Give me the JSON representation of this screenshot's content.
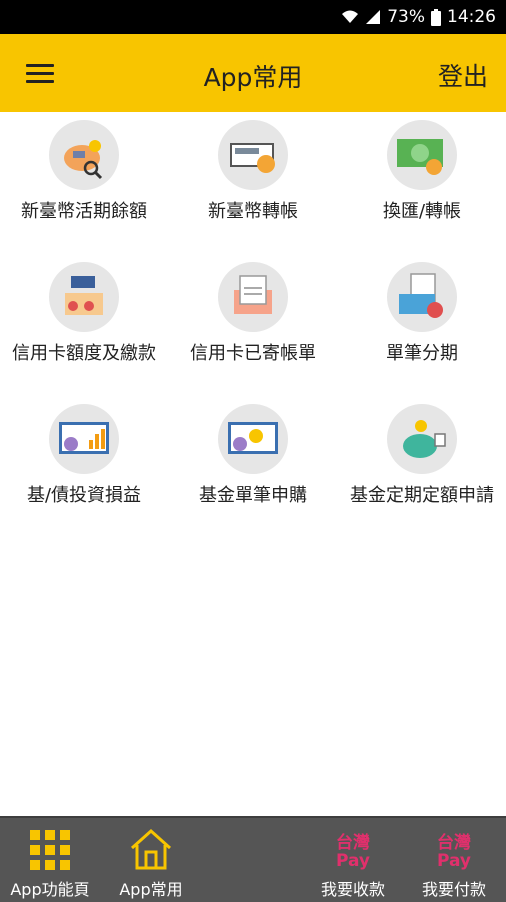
{
  "statusbar": {
    "battery": "73%",
    "time": "14:26"
  },
  "header": {
    "title": "App常用",
    "logout": "登出"
  },
  "tiles": [
    {
      "label": "新臺幣活期餘額",
      "icon": "piggy-bank-search-icon"
    },
    {
      "label": "新臺幣轉帳",
      "icon": "transfer-card-icon"
    },
    {
      "label": "換匯/轉帳",
      "icon": "banknote-exchange-icon"
    },
    {
      "label": "信用卡額度及繳款",
      "icon": "credit-limit-payment-icon"
    },
    {
      "label": "信用卡已寄帳單",
      "icon": "mailed-bill-icon"
    },
    {
      "label": "單筆分期",
      "icon": "installment-bill-icon"
    },
    {
      "label": "基/債投資損益",
      "icon": "investment-chart-icon"
    },
    {
      "label": "基金單筆申購",
      "icon": "fund-purchase-icon"
    },
    {
      "label": "基金定期定額申請",
      "icon": "piggy-regular-saving-icon"
    }
  ],
  "bottom_nav": {
    "functions": "App功能頁",
    "common": "App常用",
    "receive_logo_top": "台灣",
    "receive_logo_bottom": "Pay",
    "receive": "我要收款",
    "pay_logo_top": "台灣",
    "pay_logo_bottom": "Pay",
    "pay": "我要付款"
  },
  "colors": {
    "appbar": "#f8c500",
    "bottom_nav": "#555555",
    "accent": "#f8c500",
    "pay_brand": "#e0306c"
  }
}
